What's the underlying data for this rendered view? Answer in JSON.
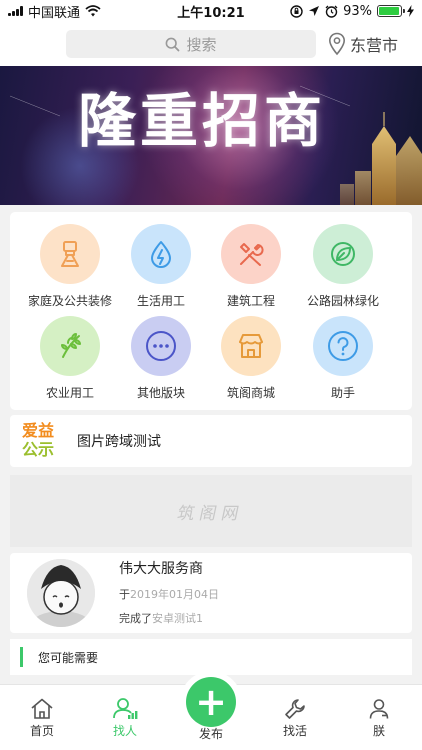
{
  "status_bar": {
    "carrier": "中国联通",
    "time": "上午10:21",
    "battery": "93%",
    "battery_level": 0.93
  },
  "header": {
    "search_placeholder": "搜索",
    "location": "东营市"
  },
  "banner": {
    "title": "隆重招商"
  },
  "categories": [
    {
      "label": "家庭及公共装修",
      "icon": "paint-brush-icon",
      "bg": "#fde2c8",
      "fg": "#f0a056"
    },
    {
      "label": "生活用工",
      "icon": "water-drop-icon",
      "bg": "#c9e4fb",
      "fg": "#3e9be6"
    },
    {
      "label": "建筑工程",
      "icon": "tools-icon",
      "bg": "#fcd3c8",
      "fg": "#e8694e"
    },
    {
      "label": "公路园林绿化",
      "icon": "leaf-icon",
      "bg": "#cdeed6",
      "fg": "#3fb765"
    },
    {
      "label": "农业用工",
      "icon": "sprout-icon",
      "bg": "#d5f0c4",
      "fg": "#6cbf3c"
    },
    {
      "label": "其他版块",
      "icon": "more-icon",
      "bg": "#c9cdf2",
      "fg": "#4b55c8"
    },
    {
      "label": "筑阁商城",
      "icon": "store-icon",
      "bg": "#fde2c0",
      "fg": "#e69a3a"
    },
    {
      "label": "助手",
      "icon": "help-icon",
      "bg": "#c9e4fb",
      "fg": "#3e9be6"
    }
  ],
  "notice": {
    "logo_line1": "爱益",
    "logo_line2": "公示",
    "text": "图片跨域测试"
  },
  "image_placeholder": {
    "watermark": "筑阁网"
  },
  "provider": {
    "name": "伟大大服务商",
    "date_prefix": "于",
    "date": "2019年01月04日",
    "done_prefix": "完成了",
    "done_item": "安卓测试1"
  },
  "maybe_need": {
    "title": "您可能需要"
  },
  "tabbar": {
    "home": "首页",
    "find": "找人",
    "publish": "发布",
    "find_work": "找活",
    "me": "朕"
  },
  "colors": {
    "accent": "#3cc86a"
  }
}
